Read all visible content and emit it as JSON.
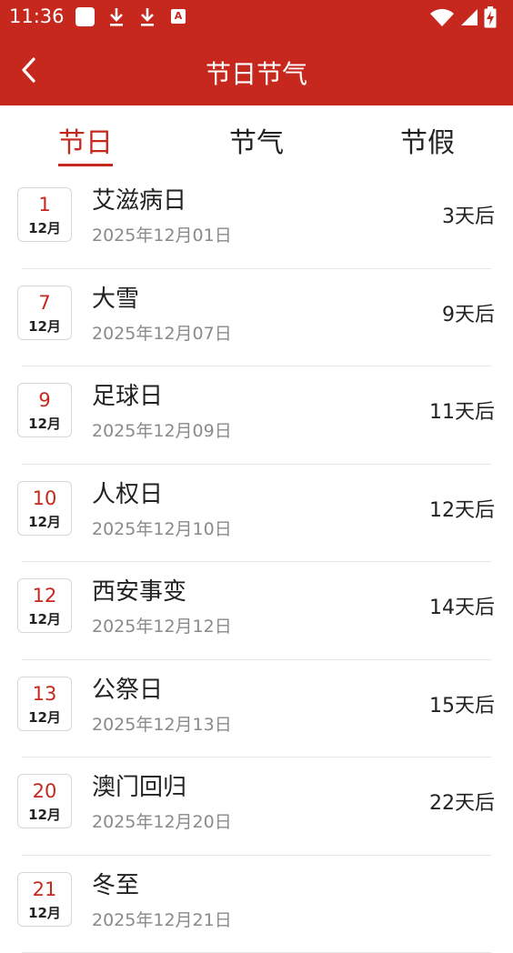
{
  "status_bar": {
    "time": "11:36",
    "a_label": "A"
  },
  "header": {
    "title": "节日节气"
  },
  "tabs": [
    {
      "label": "节日",
      "active": true
    },
    {
      "label": "节气",
      "active": false
    },
    {
      "label": "节假",
      "active": false
    }
  ],
  "items": [
    {
      "day": "1",
      "month": "12月",
      "name": "艾滋病日",
      "date": "2025年12月01日",
      "countdown": "3天后"
    },
    {
      "day": "7",
      "month": "12月",
      "name": "大雪",
      "date": "2025年12月07日",
      "countdown": "9天后"
    },
    {
      "day": "9",
      "month": "12月",
      "name": "足球日",
      "date": "2025年12月09日",
      "countdown": "11天后"
    },
    {
      "day": "10",
      "month": "12月",
      "name": "人权日",
      "date": "2025年12月10日",
      "countdown": "12天后"
    },
    {
      "day": "12",
      "month": "12月",
      "name": "西安事变",
      "date": "2025年12月12日",
      "countdown": "14天后"
    },
    {
      "day": "13",
      "month": "12月",
      "name": "公祭日",
      "date": "2025年12月13日",
      "countdown": "15天后"
    },
    {
      "day": "20",
      "month": "12月",
      "name": "澳门回归",
      "date": "2025年12月20日",
      "countdown": "22天后"
    },
    {
      "day": "21",
      "month": "12月",
      "name": "冬至",
      "date": "2025年12月21日",
      "countdown": ""
    }
  ],
  "colors": {
    "primary": "#c6281e",
    "text": "#222222",
    "secondary_text": "#8a8a8a",
    "divider": "#e6e6e6"
  }
}
